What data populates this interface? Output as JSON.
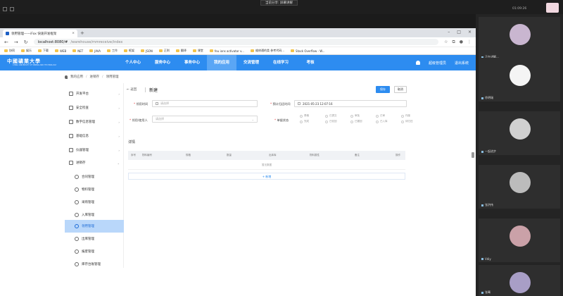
{
  "meeting": {
    "title": "当前分享: 屏幕讲解",
    "clock": "01:09:26"
  },
  "browser": {
    "tab_title": "领用管理——iFox 快速开发框架",
    "url_prefix": "localhost:8080/#",
    "url_path": "/warehouse/mmreceive/index",
    "bookmarks": [
      "协同",
      "娱乐",
      "下载",
      "WEB",
      "NET",
      "JAVA",
      "工作",
      "框架",
      "JSON",
      "正则",
      "翻译",
      "课堂",
      "feu ions activator v...",
      "维修通的类 参考代码...",
      "Stack Overflow - W..."
    ]
  },
  "header": {
    "logo": "中國礦業大學",
    "logo_sub": "CHINA UNIVERSITY OF MINING AND TECHNOLOGY",
    "nav": [
      "个人中心",
      "服务中心",
      "事务中心",
      "我的应用",
      "交流管理",
      "在线学习",
      "考核"
    ],
    "active_nav": "我的应用",
    "user": "超级管理员",
    "logout": "退出系统"
  },
  "breadcrumb": [
    "我的应用",
    "进销存",
    "领用管理"
  ],
  "sidebar": {
    "groups": [
      "开发平台",
      "安全检查",
      "数字信息管理",
      "基础信息",
      "仪器管理",
      "进销存"
    ],
    "subitems": [
      "合同管理",
      "物料管理",
      "采购管理",
      "入库管理",
      "领用管理",
      "出库管理",
      "报废管理",
      "库存台账管理"
    ],
    "active": "领用管理"
  },
  "form": {
    "back": "返回",
    "title": "新建",
    "save": "保存",
    "cancel": "取消",
    "receive_time_label": "领用时间",
    "receive_time_placeholder": "请选择",
    "expected_time_label": "预计归还时间",
    "expected_time_value": "2021-05-23 12:07:16",
    "user_label": "领用/使用人",
    "user_placeholder": "请选择",
    "status_label": "单据状态",
    "status_options": [
      "草稿",
      "已提交",
      "审批",
      "已审",
      "作废",
      "完成",
      "已驳回",
      "已撤回",
      "已入库",
      "待归还"
    ]
  },
  "detail": {
    "title": "详情",
    "columns": [
      "序号",
      "物料编号",
      "规格",
      "数量",
      "出库库",
      "物料属性",
      "备注",
      "操作"
    ],
    "empty": "暂无数据",
    "add": "+ 新增"
  },
  "participants": [
    {
      "name": "正在讲解...",
      "color": "#c9b6d0"
    },
    {
      "name": "徐明瑞",
      "color": "#f4f4f4"
    },
    {
      "name": "一起进步",
      "color": "#d0d0d0"
    },
    {
      "name": "张洪伟",
      "color": "#bcbcbc"
    },
    {
      "name": "Vdiy",
      "color": "#caa1a8"
    },
    {
      "name": "张骞",
      "color": "#a89ec6"
    },
    {
      "name": "",
      "color": "#b0306e"
    }
  ]
}
